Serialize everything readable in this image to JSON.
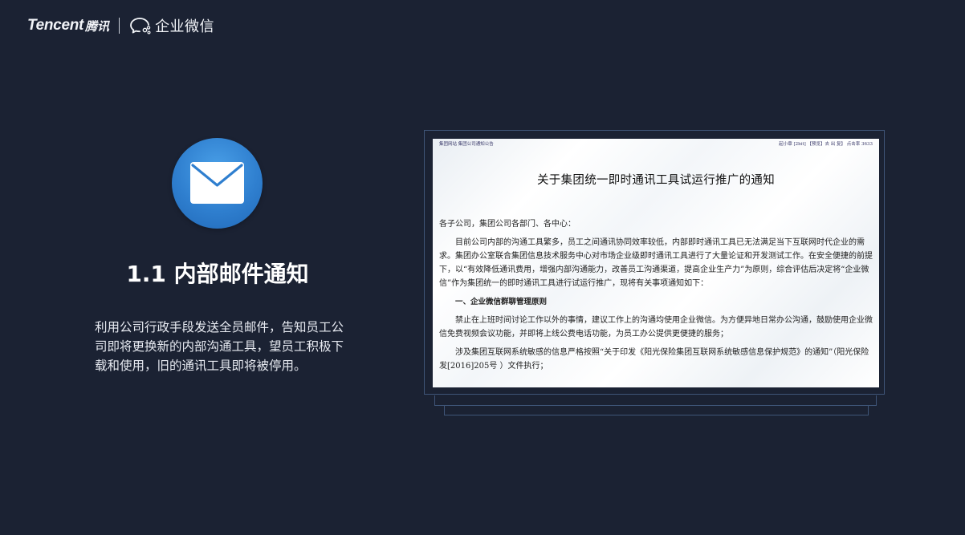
{
  "header": {
    "brand_en": "Tencent",
    "brand_cn": "腾讯",
    "product_name": "企业微信",
    "product_icon": "wework-chat-icon"
  },
  "section": {
    "icon": "mail-icon",
    "icon_color": "#2f7fcf",
    "title": "1.1 内部邮件通知",
    "description": "利用公司行政手段发送全员邮件，告知员工公司即将更换新的内部沟通工具，望员工积极下载和使用，旧的通讯工具即将被停用。"
  },
  "document": {
    "breadcrumb": "集团网站 集团公司通知公告",
    "meta": "起小章 [2bit]  【预览】去 出 复】  点击率  3633",
    "title": "关于集团统一即时通讯工具试运行推广的通知",
    "salutation": "各子公司，集团公司各部门、各中心：",
    "paragraph_1": "目前公司内部的沟通工具繁多，员工之间通讯协同效率较低，内部即时通讯工具已无法满足当下互联网时代企业的需求。集团办公室联合集团信息技术服务中心对市场企业级即时通讯工具进行了大量论证和开发测试工作。在安全便捷的前提下，以“有效降低通讯费用，增强内部沟通能力，改善员工沟通渠道，提高企业生产力”为原则，综合评估后决定将“企业微信”作为集团统一的即时通讯工具进行试运行推广，现将有关事项通知如下：",
    "heading_1": "一、企业微信群聊管理原则",
    "paragraph_2": "禁止在上班时间讨论工作以外的事情，建议工作上的沟通均使用企业微信。为方便异地日常办公沟通，鼓励使用企业微信免费视频会议功能，并即将上线公费电话功能，为员工办公提供更便捷的服务；",
    "paragraph_3": "涉及集团互联网系统敏感的信息严格按照“关于印发《阳光保险集团互联网系统敏感信息保护规范》的通知”（阳光保险发[2016]205号 ）文件执行；"
  }
}
